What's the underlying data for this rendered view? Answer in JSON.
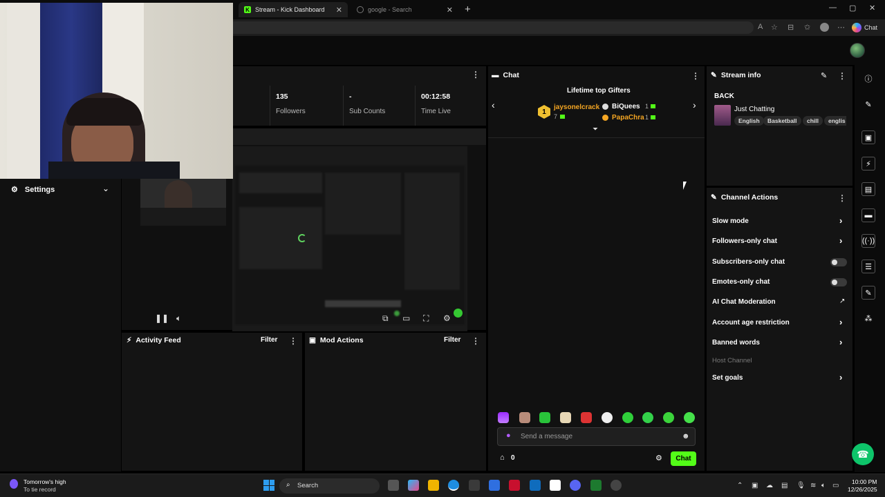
{
  "browser": {
    "tabs": [
      {
        "title": "Stream - Kick Dashboard",
        "active": true
      },
      {
        "title": "google - Search",
        "active": false
      }
    ],
    "new_tab": "+",
    "copilot_label": "Chat",
    "window_controls": [
      "—",
      "▢",
      "✕"
    ]
  },
  "dashboard": {
    "stats": [
      {
        "value": "135",
        "label": "Followers"
      },
      {
        "value": "-",
        "label": "Sub Counts"
      },
      {
        "value": "00:12:58",
        "label": "Time Live"
      }
    ],
    "settings_label": "Settings",
    "activity_feed": {
      "title": "Activity Feed",
      "filter": "Filter"
    },
    "mod_actions": {
      "title": "Mod Actions",
      "filter": "Filter"
    }
  },
  "chat": {
    "title": "Chat",
    "gifters_title": "Lifetime top Gifters",
    "gifters": [
      {
        "rank": "1",
        "name": "jaysonelcrack",
        "count": "7",
        "color": "#f5a623"
      },
      {
        "name": "BiQuees",
        "count": "1",
        "color": "#ffffff"
      },
      {
        "name": "PapaChra",
        "count": "1",
        "color": "#f5a623"
      }
    ],
    "input_placeholder": "Send a message",
    "points": "0",
    "send_label": "Chat"
  },
  "stream_info": {
    "title": "Stream info",
    "stream_title": "BACK",
    "category": "Just Chatting",
    "tags": [
      "English",
      "Basketball",
      "chill",
      "englis"
    ]
  },
  "channel_actions": {
    "title": "Channel Actions",
    "items": [
      {
        "label": "Slow mode",
        "control": "chevron"
      },
      {
        "label": "Followers-only chat",
        "control": "chevron"
      },
      {
        "label": "Subscribers-only chat",
        "control": "toggle",
        "on": false
      },
      {
        "label": "Emotes-only chat",
        "control": "toggle",
        "on": false
      },
      {
        "label": "AI Chat Moderation",
        "control": "external"
      },
      {
        "label": "Account age restriction",
        "control": "chevron"
      },
      {
        "label": "Banned words",
        "control": "chevron"
      },
      {
        "label": "Host Channel",
        "control": "none",
        "disabled": true
      },
      {
        "label": "Set goals",
        "control": "chevron"
      }
    ]
  },
  "taskbar": {
    "weather_title": "Tomorrow's high",
    "weather_sub": "To tie record",
    "search_label": "Search",
    "time": "10:00 PM",
    "date": "12/26/2025"
  },
  "colors": {
    "kick_green": "#53fc18",
    "panel_bg": "#141414",
    "accent_orange": "#f5a623"
  }
}
